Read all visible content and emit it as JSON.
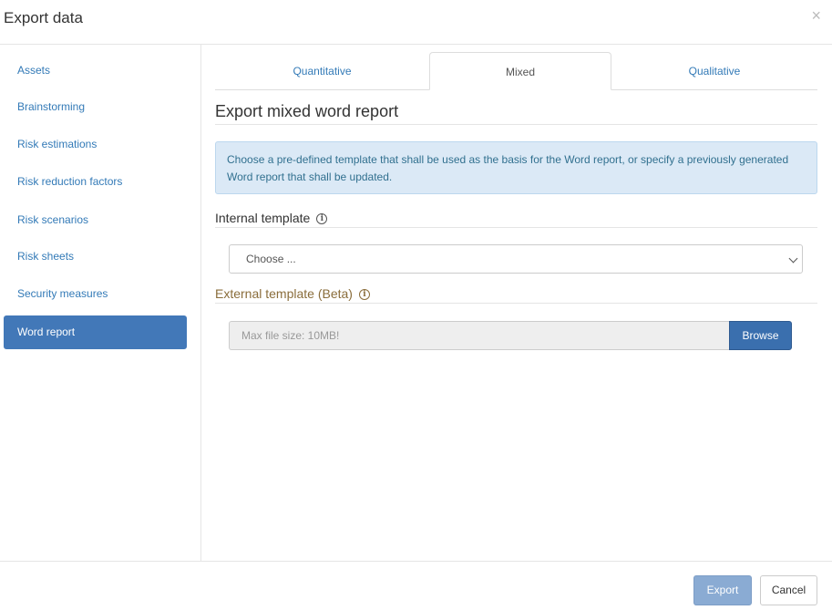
{
  "dialog": {
    "title": "Export data",
    "close_glyph": "×"
  },
  "sidebar": {
    "items": [
      {
        "label": "Assets"
      },
      {
        "label": "Brainstorming"
      },
      {
        "label": "Risk estimations"
      },
      {
        "label": "Risk reduction factors"
      },
      {
        "label": "Risk scenarios"
      },
      {
        "label": "Risk sheets"
      },
      {
        "label": "Security measures"
      },
      {
        "label": "Word report",
        "active": true
      }
    ]
  },
  "tabs": [
    {
      "label": "Quantitative"
    },
    {
      "label": "Mixed",
      "active": true
    },
    {
      "label": "Qualitative"
    }
  ],
  "main": {
    "section_title": "Export mixed word report",
    "info_text": "Choose a pre-defined template that shall be used as the basis for the Word report, or specify a previously generated Word report that shall be updated.",
    "internal_template": {
      "label": "Internal template",
      "icon": "info-icon",
      "select_value": "Choose ..."
    },
    "external_template": {
      "label": "External template (Beta)",
      "icon": "info-icon",
      "placeholder": "Max file size: 10MB!",
      "browse_label": "Browse"
    }
  },
  "footer": {
    "export_label": "Export",
    "cancel_label": "Cancel"
  },
  "colors": {
    "accent": "#4278b8",
    "link": "#337ab7",
    "info_bg": "#dbe9f6",
    "warning_text": "#8a6d3b"
  }
}
